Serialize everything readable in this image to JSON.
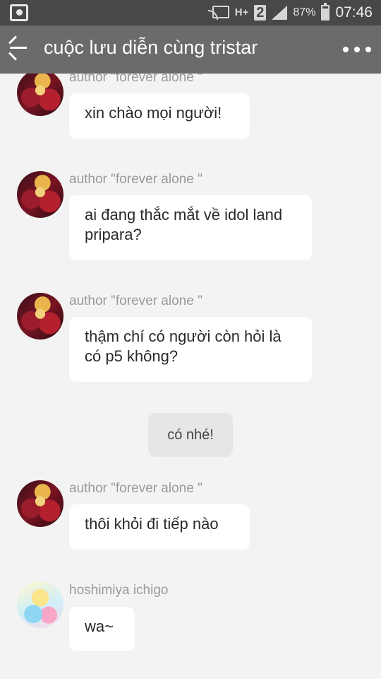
{
  "status_bar": {
    "network": "H+",
    "sim": "2",
    "battery_pct": "87%",
    "time": "07:46"
  },
  "app_bar": {
    "title": "cuộc lưu diễn cùng tristar"
  },
  "messages": [
    {
      "author": "author \"forever alone \"",
      "text": "xin chào mọi người!"
    },
    {
      "author": "author \"forever alone \"",
      "text": "ai đang thắc mắt về idol land pripara?"
    },
    {
      "author": "author \"forever alone \"",
      "text": "thậm chí có người còn hỏi là có p5 không?"
    },
    {
      "system": "có nhé!"
    },
    {
      "author": "author \"forever alone \"",
      "text": "thôi khỏi đi tiếp nào"
    },
    {
      "author": "hoshimiya ichigo",
      "text": "wa~"
    }
  ]
}
